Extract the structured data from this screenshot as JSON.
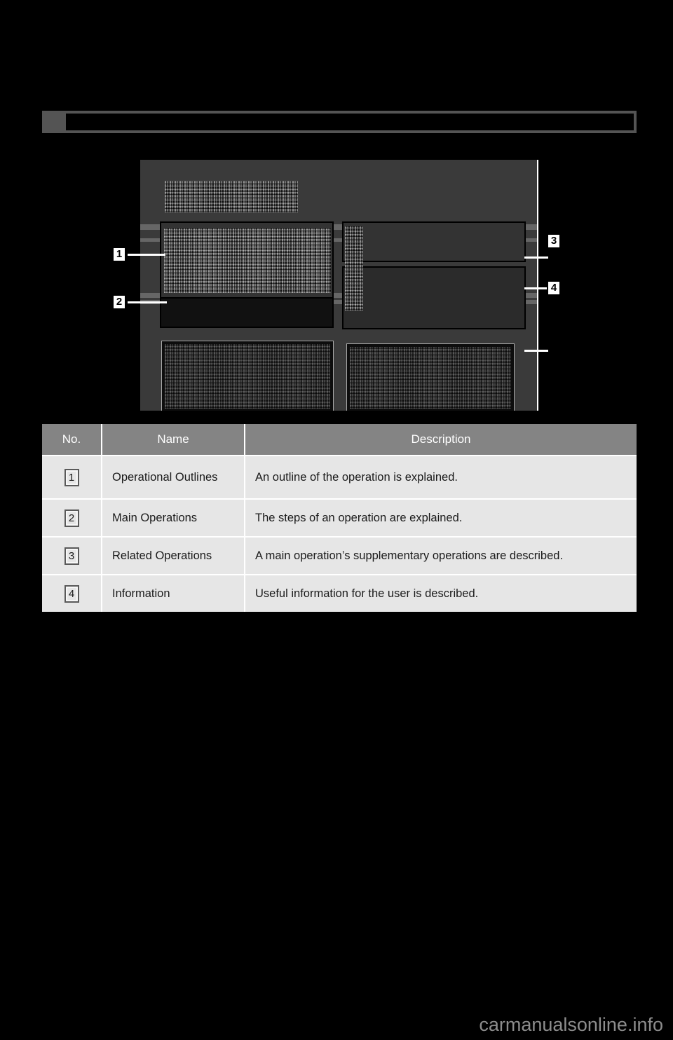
{
  "page": {
    "background_color": "#000000",
    "header": {
      "title": "",
      "bar_color": "#545454"
    },
    "watermark": "carmanualsonline.info"
  },
  "figure": {
    "name": "manual-page-layout-example",
    "background_color": "#3a3a3a",
    "obscured": true,
    "callouts": [
      {
        "number": "1",
        "target": "operational-outlines-region"
      },
      {
        "number": "2",
        "target": "main-operations-region"
      },
      {
        "number": "3",
        "target": "related-operations-region"
      },
      {
        "number": "4",
        "target": "information-region"
      }
    ]
  },
  "legend": {
    "columns": [
      "No.",
      "Name",
      "Description"
    ],
    "rows": [
      {
        "no": "1",
        "name": "Operational Outlines",
        "description": "An outline of the operation is explained."
      },
      {
        "no": "2",
        "name": "Main Operations",
        "description": "The steps of an operation are explained."
      },
      {
        "no": "3",
        "name": "Related Operations",
        "description": "A main operation’s supplementary operations are described."
      },
      {
        "no": "4",
        "name": "Information",
        "description": "Useful information for the user is described."
      }
    ],
    "header_bg": "#848484",
    "row_bg": "#e6e6e6"
  }
}
